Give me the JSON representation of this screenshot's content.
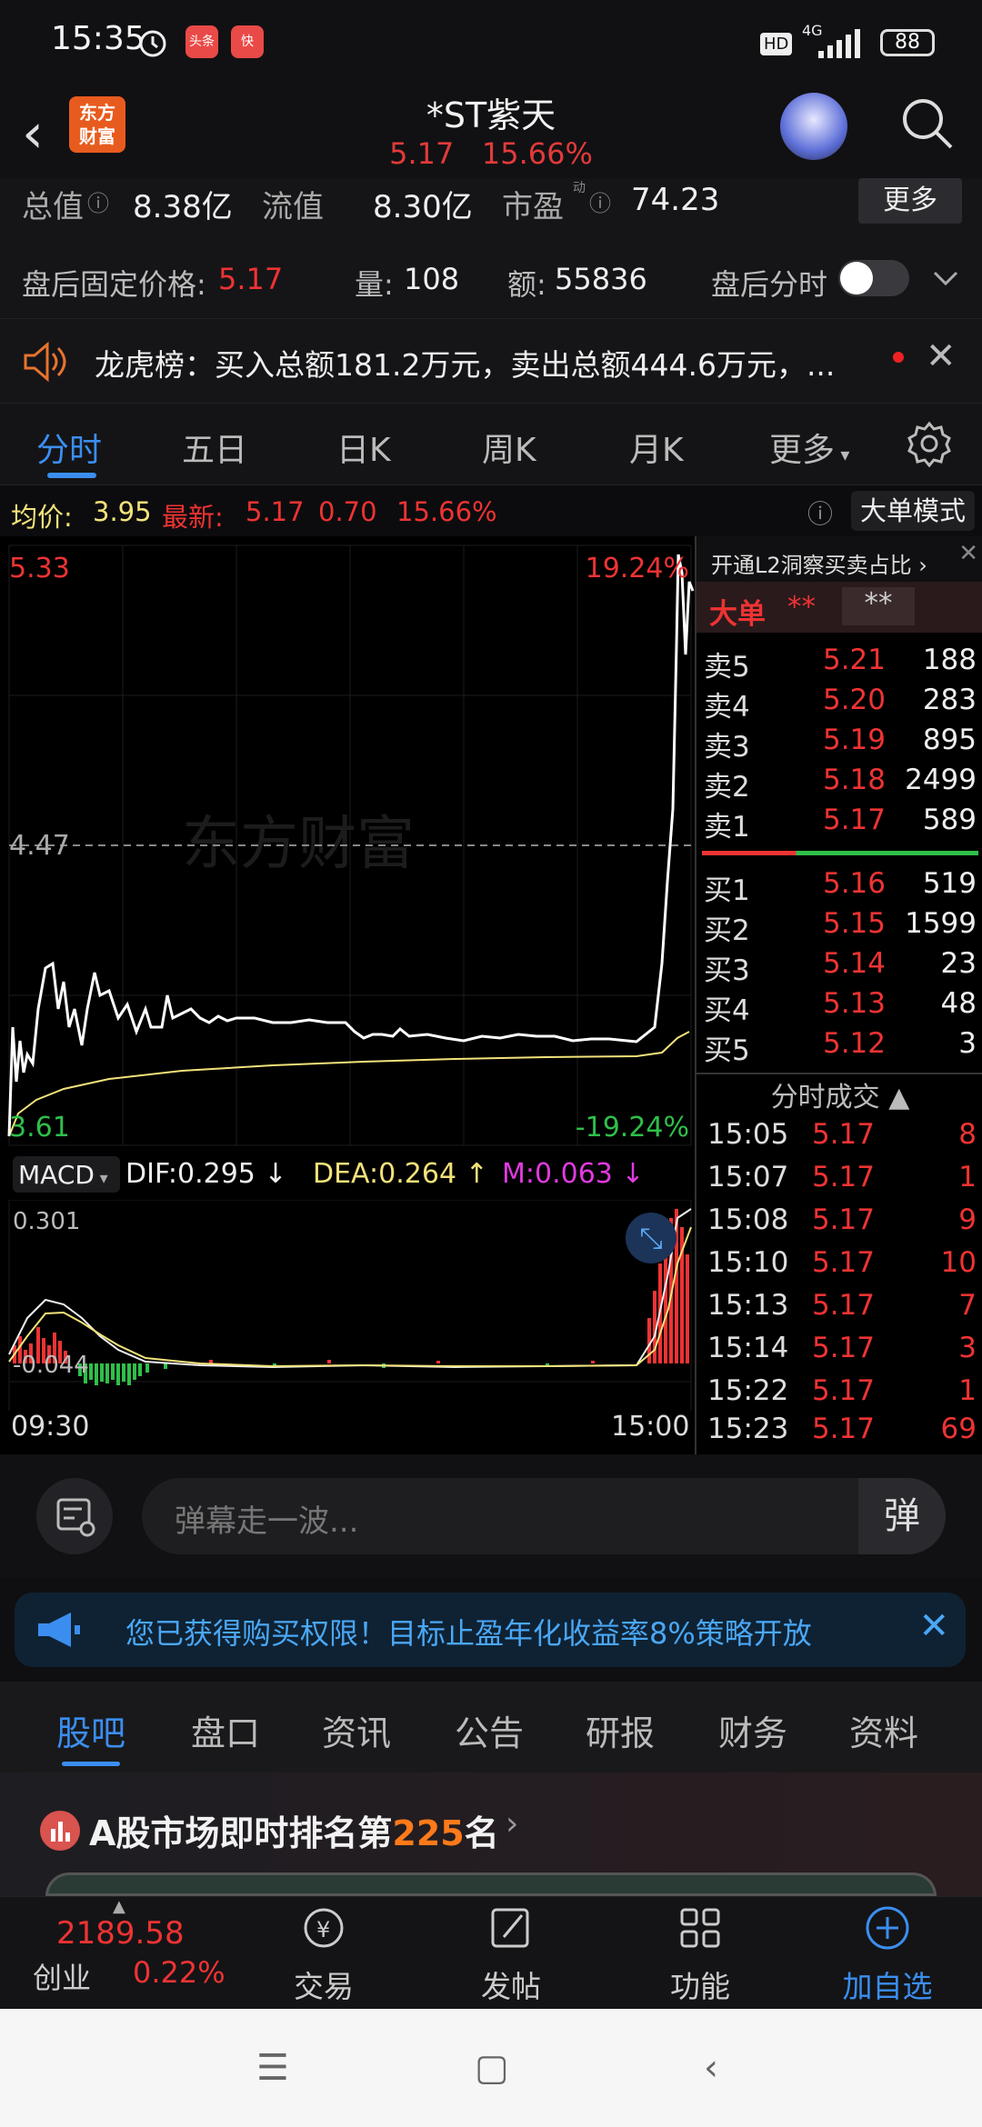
{
  "status_bar": {
    "time": "15:35",
    "app1": "头条",
    "app2": "快",
    "hd": "HD",
    "net": "4G",
    "battery": "88"
  },
  "header": {
    "title": "*ST紫天",
    "price": "5.17",
    "change_pct": "15.66%",
    "logo_line1": "东方",
    "logo_line2": "财富"
  },
  "stats_row": {
    "total_label": "总值",
    "total_value": "8.38亿",
    "float_label": "流值",
    "float_value": "8.30亿",
    "pe_label": "市盈",
    "pe_sup": "动",
    "pe_value": "74.23",
    "more": "更多"
  },
  "after_hours": {
    "price_label": "盘后固定价格:",
    "price": "5.17",
    "vol_label": "量:",
    "vol": "108",
    "amt_label": "额:",
    "amt": "55836",
    "timeshare_label": "盘后分时"
  },
  "notice": {
    "text": "龙虎榜：买入总额181.2万元，卖出总额444.6万元，..."
  },
  "tabs": [
    "分时",
    "五日",
    "日K",
    "周K",
    "月K",
    "更多"
  ],
  "quote_bar": {
    "avg_label": "均价:",
    "avg": "3.95",
    "last_label": "最新:",
    "last": "5.17",
    "chg": "0.70",
    "pct": "15.66%",
    "big_order_mode": "大单模式"
  },
  "chart": {
    "high": "5.33",
    "mid": "4.47",
    "low": "3.61",
    "up_pct": "19.24%",
    "down_pct": "-19.24%",
    "watermark": "东方财富",
    "start_time": "09:30",
    "end_time": "15:00"
  },
  "macd": {
    "label": "MACD",
    "dif": "DIF:0.295",
    "dea": "DEA:0.264",
    "m": "M:0.063",
    "top": "0.301",
    "bottom": "-0.044"
  },
  "orderbook": {
    "l2_text": "开通L2洞察买卖占比",
    "big_label": "大单",
    "big_mask1": "**",
    "big_mask2": "**",
    "asks": [
      {
        "label": "卖5",
        "price": "5.21",
        "vol": "188"
      },
      {
        "label": "卖4",
        "price": "5.20",
        "vol": "283"
      },
      {
        "label": "卖3",
        "price": "5.19",
        "vol": "895"
      },
      {
        "label": "卖2",
        "price": "5.18",
        "vol": "2499"
      },
      {
        "label": "卖1",
        "price": "5.17",
        "vol": "589"
      }
    ],
    "bids": [
      {
        "label": "买1",
        "price": "5.16",
        "vol": "519"
      },
      {
        "label": "买2",
        "price": "5.15",
        "vol": "1599"
      },
      {
        "label": "买3",
        "price": "5.14",
        "vol": "23"
      },
      {
        "label": "买4",
        "price": "5.13",
        "vol": "48"
      },
      {
        "label": "买5",
        "price": "5.12",
        "vol": "3"
      }
    ],
    "ticks_title": "分时成交",
    "ticks": [
      {
        "time": "15:05",
        "price": "5.17",
        "vol": "8"
      },
      {
        "time": "15:07",
        "price": "5.17",
        "vol": "1"
      },
      {
        "time": "15:08",
        "price": "5.17",
        "vol": "9"
      },
      {
        "time": "15:10",
        "price": "5.17",
        "vol": "10"
      },
      {
        "time": "15:13",
        "price": "5.17",
        "vol": "7"
      },
      {
        "time": "15:14",
        "price": "5.17",
        "vol": "3"
      },
      {
        "time": "15:22",
        "price": "5.17",
        "vol": "1"
      },
      {
        "time": "15:23",
        "price": "5.17",
        "vol": "69"
      }
    ]
  },
  "danmu": {
    "placeholder": "弹幕走一波...",
    "btn": "弹"
  },
  "promo": {
    "text": "您已获得购买权限！目标止盈年化收益率8%策略开放"
  },
  "bottom_tabs": [
    "股吧",
    "盘口",
    "资讯",
    "公告",
    "研报",
    "财务",
    "资料"
  ],
  "rank": {
    "prefix": "A股市场即时排名第",
    "num": "225",
    "suffix": "名"
  },
  "bottom_nav": {
    "index_value": "2189.58",
    "index_name": "创业",
    "index_pct": "0.22%",
    "trade": "交易",
    "post": "发帖",
    "func": "功能",
    "add": "加自选"
  },
  "colors": {
    "up": "#e33b3b",
    "down": "#2fbf4a",
    "accent": "#3b8ef0",
    "price_line": "#ffffff",
    "avg_line": "#f3e27a"
  }
}
